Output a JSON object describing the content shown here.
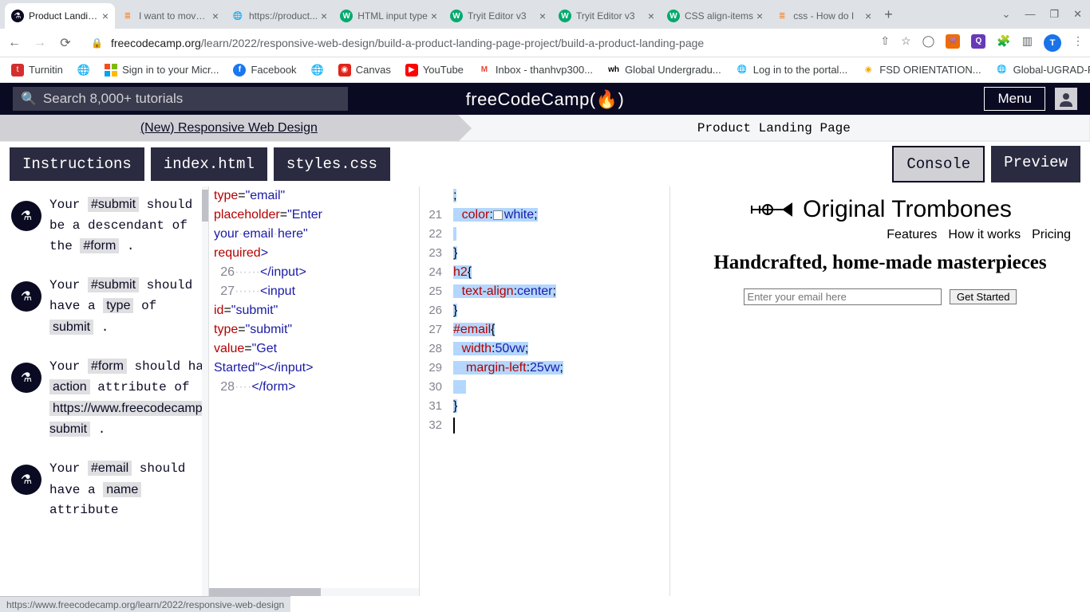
{
  "browser": {
    "tabs": [
      {
        "title": "Product Landing Page",
        "active": true,
        "icon": "fcc"
      },
      {
        "title": "I want to move a form",
        "icon": "so"
      },
      {
        "title": "https://product...",
        "icon": "globe"
      },
      {
        "title": "HTML input type",
        "icon": "w3"
      },
      {
        "title": "Tryit Editor v3",
        "icon": "w3"
      },
      {
        "title": "Tryit Editor v3",
        "icon": "w3"
      },
      {
        "title": "CSS align-items",
        "icon": "w3"
      },
      {
        "title": "css - How do I",
        "icon": "so"
      }
    ],
    "url_host": "freecodecamp.org",
    "url_path": "/learn/2022/responsive-web-design/build-a-product-landing-page-project/build-a-product-landing-page",
    "bookmarks": [
      {
        "label": "Turnitin",
        "color": "#d32f2f"
      },
      {
        "label": "Sign in to your Micr...",
        "color": "ms"
      },
      {
        "label": "Facebook",
        "color": "#1877f2"
      },
      {
        "label": "Canvas",
        "color": "#e2231a"
      },
      {
        "label": "YouTube",
        "color": "#ff0000"
      },
      {
        "label": "Inbox - thanhvp300...",
        "color": "gm"
      },
      {
        "label": "Global Undergradu...",
        "color": "#000"
      },
      {
        "label": "Log in to the portal...",
        "color": "#666"
      },
      {
        "label": "FSD ORIENTATION...",
        "color": "#f2a900"
      },
      {
        "label": "Global-UGRAD-Pro...",
        "color": "#666"
      }
    ],
    "avatar": "T"
  },
  "fcc": {
    "search_placeholder": "Search 8,000+ tutorials",
    "brand": "freeCodeCamp",
    "menu": "Menu",
    "crumb_left": "(New) Responsive Web Design",
    "crumb_right": "Product Landing Page"
  },
  "editor_tabs": {
    "instructions": "Instructions",
    "html": "index.html",
    "css": "styles.css",
    "console": "Console",
    "preview": "Preview"
  },
  "instructions": [
    {
      "html": "Your <code>#submit</code> should be a descendant of the <code>#form</code> ."
    },
    {
      "html": "Your <code>#submit</code> should have a <code>type</code> of <code>submit</code> ."
    },
    {
      "html": "Your <code>#form</code> should have an <code>action</code> attribute of <code>https://www.freecodecamp.com/email-submit</code> ."
    },
    {
      "html": "Your <code>#email</code> should have a <code>name</code> attribute"
    }
  ],
  "html_code": {
    "start_frag": "type=\"email\" placeholder=\"Enter your email here\" required>",
    "lines": [
      {
        "n": "26",
        "t": "      </input>"
      },
      {
        "n": "27",
        "t": "      <input id=\"submit\" type=\"submit\" value=\"Get Started\"></input>"
      },
      {
        "n": "28",
        "t": "    </form>"
      }
    ]
  },
  "css_lines": [
    {
      "n": "",
      "body": ";"
    },
    {
      "n": "21",
      "body": "  color: white;"
    },
    {
      "n": "22",
      "body": ""
    },
    {
      "n": "23",
      "body": "}"
    },
    {
      "n": "24",
      "body": "h2{"
    },
    {
      "n": "25",
      "body": "  text-align:center;"
    },
    {
      "n": "26",
      "body": "}"
    },
    {
      "n": "27",
      "body": "#email{"
    },
    {
      "n": "28",
      "body": "  width: 50vw;"
    },
    {
      "n": "29",
      "body": "   margin-left : 25vw;"
    },
    {
      "n": "30",
      "body": "   "
    },
    {
      "n": "31",
      "body": "}"
    },
    {
      "n": "32",
      "body": ""
    }
  ],
  "preview": {
    "brand": "Original Trombones",
    "nav": [
      "Features",
      "How it works",
      "Pricing"
    ],
    "h2": "Handcrafted, home-made masterpieces",
    "email_placeholder": "Enter your email here",
    "submit": "Get Started"
  },
  "status_url": "https://www.freecodecamp.org/learn/2022/responsive-web-design"
}
